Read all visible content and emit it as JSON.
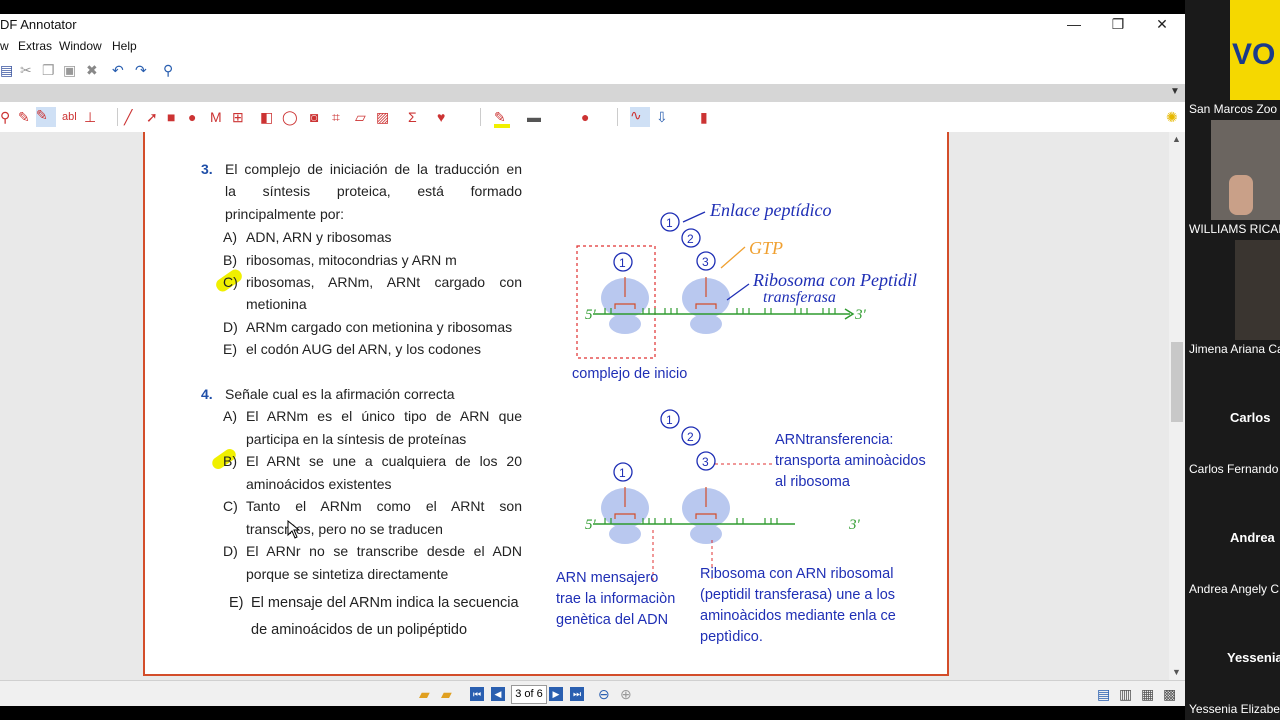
{
  "app": {
    "title": "DF Annotator",
    "min_label": "—",
    "max_label": "❐",
    "close_label": "✕"
  },
  "menu": [
    "w",
    "Extras",
    "Window",
    "Help"
  ],
  "question3": {
    "number": "3.",
    "stem_line1": "El complejo de iniciación de la traducción en",
    "stem_line2": "la síntesis proteica, está formado",
    "stem_line3": "principalmente por:",
    "options": [
      {
        "letter": "A)",
        "line1": "ADN, ARN y ribosomas",
        "line2": ""
      },
      {
        "letter": "B)",
        "line1": "ribosomas, mitocondrias y ARN m",
        "line2": ""
      },
      {
        "letter": "C)",
        "line1": "ribosomas, ARNm, ARNt cargado con",
        "line2": "metionina"
      },
      {
        "letter": "D)",
        "line1": "ARNm cargado con metionina y ribosomas",
        "line2": ""
      },
      {
        "letter": "E)",
        "line1": "el codón AUG del ARN, y los codones",
        "line2": ""
      }
    ]
  },
  "question4": {
    "number": "4.",
    "stem": "Señale cual es la afirmación correcta",
    "options": [
      {
        "letter": "A)",
        "line1": "El ARNm es el único tipo de ARN que",
        "line2": "participa en la síntesis de proteínas"
      },
      {
        "letter": "B)",
        "line1": "El ARNt se une a cualquiera de los 20",
        "line2": "aminoácidos existentes"
      },
      {
        "letter": "C)",
        "line1": "Tanto el ARNm como el ARNt son",
        "line2": "transcritos, pero no se traducen"
      },
      {
        "letter": "D)",
        "line1": "El ARNr no se transcribe desde el ADN",
        "line2": "porque se sintetiza directamente"
      },
      {
        "letter": "E)",
        "line1": "El mensaje del ARNm indica la secuencia",
        "line2": "de aminoácidos de un polipéptido"
      }
    ]
  },
  "diagram_top": {
    "handwritten_peptide": "Enlace peptídico",
    "handwritten_gtp": "GTP",
    "handwritten_ribosome_1": "Ribosoma con Peptidil",
    "handwritten_ribosome_2": "transferasa",
    "five_prime": "5'",
    "three_prime": "3'",
    "caption": "complejo de inicio",
    "n1": "1",
    "n2": "2",
    "n3": "3"
  },
  "diagram_bottom": {
    "arnt_label_1": "ARNtransferencia:",
    "arnt_label_2": "transporta aminoàcidos",
    "arnt_label_3": "al ribosoma",
    "arnm_label_1": "ARN mensajero",
    "arnm_label_2": "trae la informaciòn",
    "arnm_label_3": "genètica del ADN",
    "rib_label_1": "Ribosoma con ARN ribosomal",
    "rib_label_2": "(peptidil transferasa) une a los",
    "rib_label_3": "aminoàcidos mediante enla ce",
    "rib_label_4": "peptìdico.",
    "five_prime": "5'",
    "three_prime": "3'",
    "n1": "1",
    "n2": "2",
    "n3": "3"
  },
  "status": {
    "page_indicator": "3 of 6"
  },
  "participants": [
    {
      "name": "San Marcos Zoo",
      "big": ""
    },
    {
      "name": "WILLIAMS RICAR",
      "big": ""
    },
    {
      "name": "Jimena Ariana Ca",
      "big": ""
    },
    {
      "name": "Carlos Fernando",
      "big": "Carlos"
    },
    {
      "name": "Andrea Angely C",
      "big": "Andrea"
    },
    {
      "name": "Yessenia Elizabet",
      "big": "Yessenia"
    }
  ],
  "logo_text": "VO",
  "colors": {
    "accent_blue": "#1f2fb5",
    "page_border": "#d34d2a",
    "highlight_yellow": "#f0f000",
    "strand_green": "#2e9b2e"
  }
}
